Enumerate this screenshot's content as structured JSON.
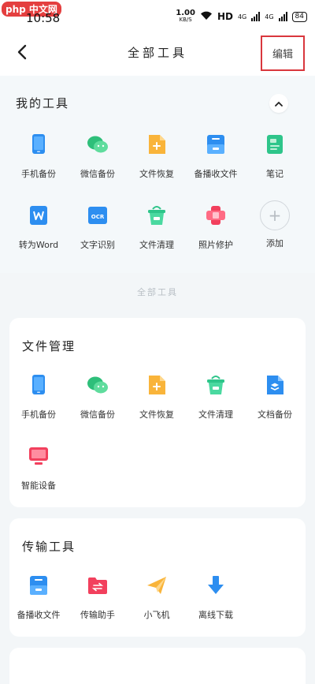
{
  "status_bar": {
    "watermark": "php 中文网",
    "time": "10:58",
    "speed_value": "1.00",
    "speed_unit": "KB/S",
    "hd": "HD",
    "network_1": "4G",
    "network_2": "4G",
    "battery": "84"
  },
  "header": {
    "title": "全部工具",
    "edit_label": "编辑"
  },
  "my_tools": {
    "title": "我的工具",
    "items": [
      {
        "label": "手机备份",
        "icon": "phone-backup-icon"
      },
      {
        "label": "微信备份",
        "icon": "wechat-backup-icon"
      },
      {
        "label": "文件恢复",
        "icon": "file-recovery-icon"
      },
      {
        "label": "备播收文件",
        "icon": "receive-files-icon"
      },
      {
        "label": "笔记",
        "icon": "notes-icon"
      },
      {
        "label": "转为Word",
        "icon": "to-word-icon"
      },
      {
        "label": "文字识别",
        "icon": "ocr-icon"
      },
      {
        "label": "文件清理",
        "icon": "file-clean-icon"
      },
      {
        "label": "照片修护",
        "icon": "photo-repair-icon"
      },
      {
        "label": "添加",
        "icon": "add-icon"
      }
    ]
  },
  "divider_label": "全部工具",
  "file_management": {
    "title": "文件管理",
    "items": [
      {
        "label": "手机备份",
        "icon": "phone-backup-icon"
      },
      {
        "label": "微信备份",
        "icon": "wechat-backup-icon"
      },
      {
        "label": "文件恢复",
        "icon": "file-recovery-icon"
      },
      {
        "label": "文件清理",
        "icon": "file-clean-icon"
      },
      {
        "label": "文档备份",
        "icon": "doc-backup-icon"
      },
      {
        "label": "智能设备",
        "icon": "smart-device-icon"
      }
    ]
  },
  "transfer_tools": {
    "title": "传输工具",
    "items": [
      {
        "label": "备播收文件",
        "icon": "receive-files-icon"
      },
      {
        "label": "传输助手",
        "icon": "transfer-assistant-icon"
      },
      {
        "label": "小飞机",
        "icon": "paper-plane-icon"
      },
      {
        "label": "离线下载",
        "icon": "offline-download-icon"
      }
    ]
  }
}
